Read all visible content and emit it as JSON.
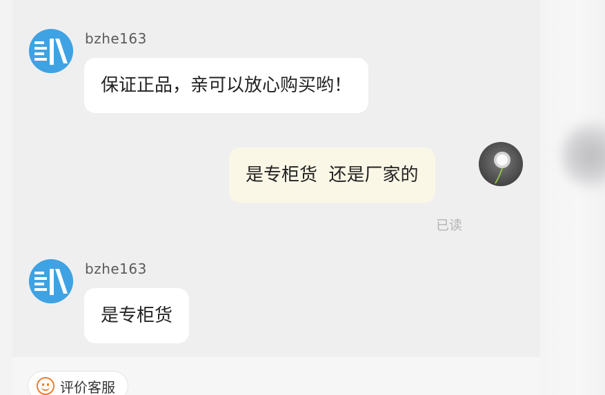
{
  "messages": [
    {
      "side": "left",
      "sender": "bzhe163",
      "text": "保证正品，亲可以放心购买哟！"
    },
    {
      "side": "right",
      "text": "是专柜货  还是厂家的",
      "status": "已读"
    },
    {
      "side": "left",
      "sender": "bzhe163",
      "text": "是专柜货"
    }
  ],
  "bottom_bar": {
    "review_label": "评价客服"
  },
  "icons": {
    "shop_avatar": "shop-logo-icon",
    "user_avatar": "dandelion-avatar-icon",
    "review": "smile-icon"
  },
  "colors": {
    "shop_avatar_bg": "#3fa2e3",
    "own_bubble_bg": "#fbf7e7",
    "review_icon": "#f07a2a"
  }
}
